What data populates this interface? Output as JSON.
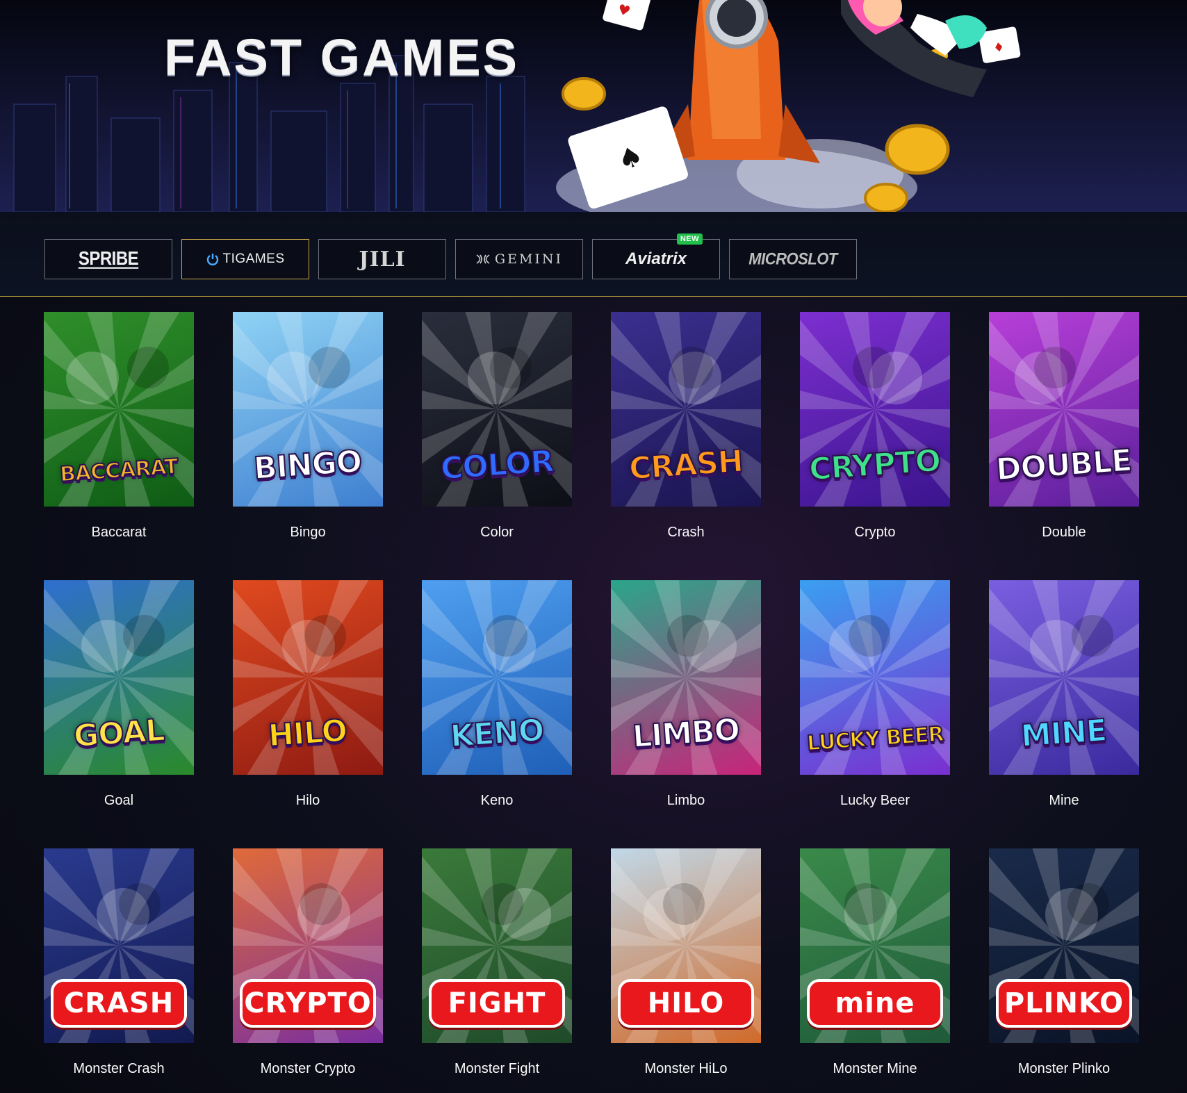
{
  "banner": {
    "title": "FAST GAMES"
  },
  "providers": [
    {
      "label": "SPRIBE",
      "active": false
    },
    {
      "label": "TIGAMES",
      "active": true
    },
    {
      "label": "JILI",
      "active": false
    },
    {
      "label": "GEMINI",
      "active": false
    },
    {
      "label": "Aviatrix",
      "active": false,
      "badge": "NEW"
    },
    {
      "label": "MICROSLOT",
      "active": false
    }
  ],
  "games": [
    {
      "title": "Baccarat",
      "art_text": "BACCARAT",
      "bg": [
        "#2f8f2a",
        "#0f5c16"
      ],
      "text_color": "#f6b52a"
    },
    {
      "title": "Bingo",
      "art_text": "BINGO",
      "bg": [
        "#8fd3f5",
        "#3e7fd0"
      ],
      "text_color": "#ffffff"
    },
    {
      "title": "Color",
      "art_text": "COLOR",
      "bg": [
        "#2a2e3c",
        "#0d0f17"
      ],
      "text_color": "#2f6bff"
    },
    {
      "title": "Crash",
      "art_text": "CRASH",
      "bg": [
        "#3b2f8f",
        "#1a1550"
      ],
      "text_color": "#ff9a1c"
    },
    {
      "title": "Crypto",
      "art_text": "CRYPTO",
      "bg": [
        "#7d2fd0",
        "#3a148e"
      ],
      "text_color": "#3fe08a"
    },
    {
      "title": "Double",
      "art_text": "DOUBLE",
      "bg": [
        "#b83fd9",
        "#5a1f9a"
      ],
      "text_color": "#ffffff"
    },
    {
      "title": "Goal",
      "art_text": "GOAL",
      "bg": [
        "#2f6fd0",
        "#2a8a2a"
      ],
      "text_color": "#ffe14a"
    },
    {
      "title": "Hilo",
      "art_text": "HILO",
      "bg": [
        "#e04a1f",
        "#8e1a12"
      ],
      "text_color": "#ffd21a"
    },
    {
      "title": "Keno",
      "art_text": "KENO",
      "bg": [
        "#4f9ff0",
        "#1f5fb8"
      ],
      "text_color": "#5fd6f0"
    },
    {
      "title": "Limbo",
      "art_text": "LIMBO",
      "bg": [
        "#2aa68a",
        "#c8247a"
      ],
      "text_color": "#ffffff"
    },
    {
      "title": "Lucky Beer",
      "art_text": "LUCKY BEER",
      "bg": [
        "#3a9ff0",
        "#7a2fd0"
      ],
      "text_color": "#ffd21a"
    },
    {
      "title": "Mine",
      "art_text": "MINE",
      "bg": [
        "#7a5fe0",
        "#3a2a9e"
      ],
      "text_color": "#4fd8ff"
    },
    {
      "title": "Monster Crash",
      "art_text": "CRASH",
      "bg": [
        "#2a3a8e",
        "#121a50"
      ]
    },
    {
      "title": "Monster Crypto",
      "art_text": "CRYPTO",
      "bg": [
        "#e06a3a",
        "#7a2f9e"
      ]
    },
    {
      "title": "Monster Fight",
      "art_text": "FIGHT",
      "bg": [
        "#3a7a3a",
        "#1f4a2a"
      ]
    },
    {
      "title": "Monster HiLo",
      "art_text": "HILO",
      "bg": [
        "#c0d8e8",
        "#d06a2a"
      ]
    },
    {
      "title": "Monster Mine",
      "art_text": "mine",
      "bg": [
        "#3a8a4a",
        "#1f5a3a"
      ]
    },
    {
      "title": "Monster Plinko",
      "art_text": "PLINKO",
      "bg": [
        "#1a2a4a",
        "#0a1428"
      ]
    }
  ]
}
